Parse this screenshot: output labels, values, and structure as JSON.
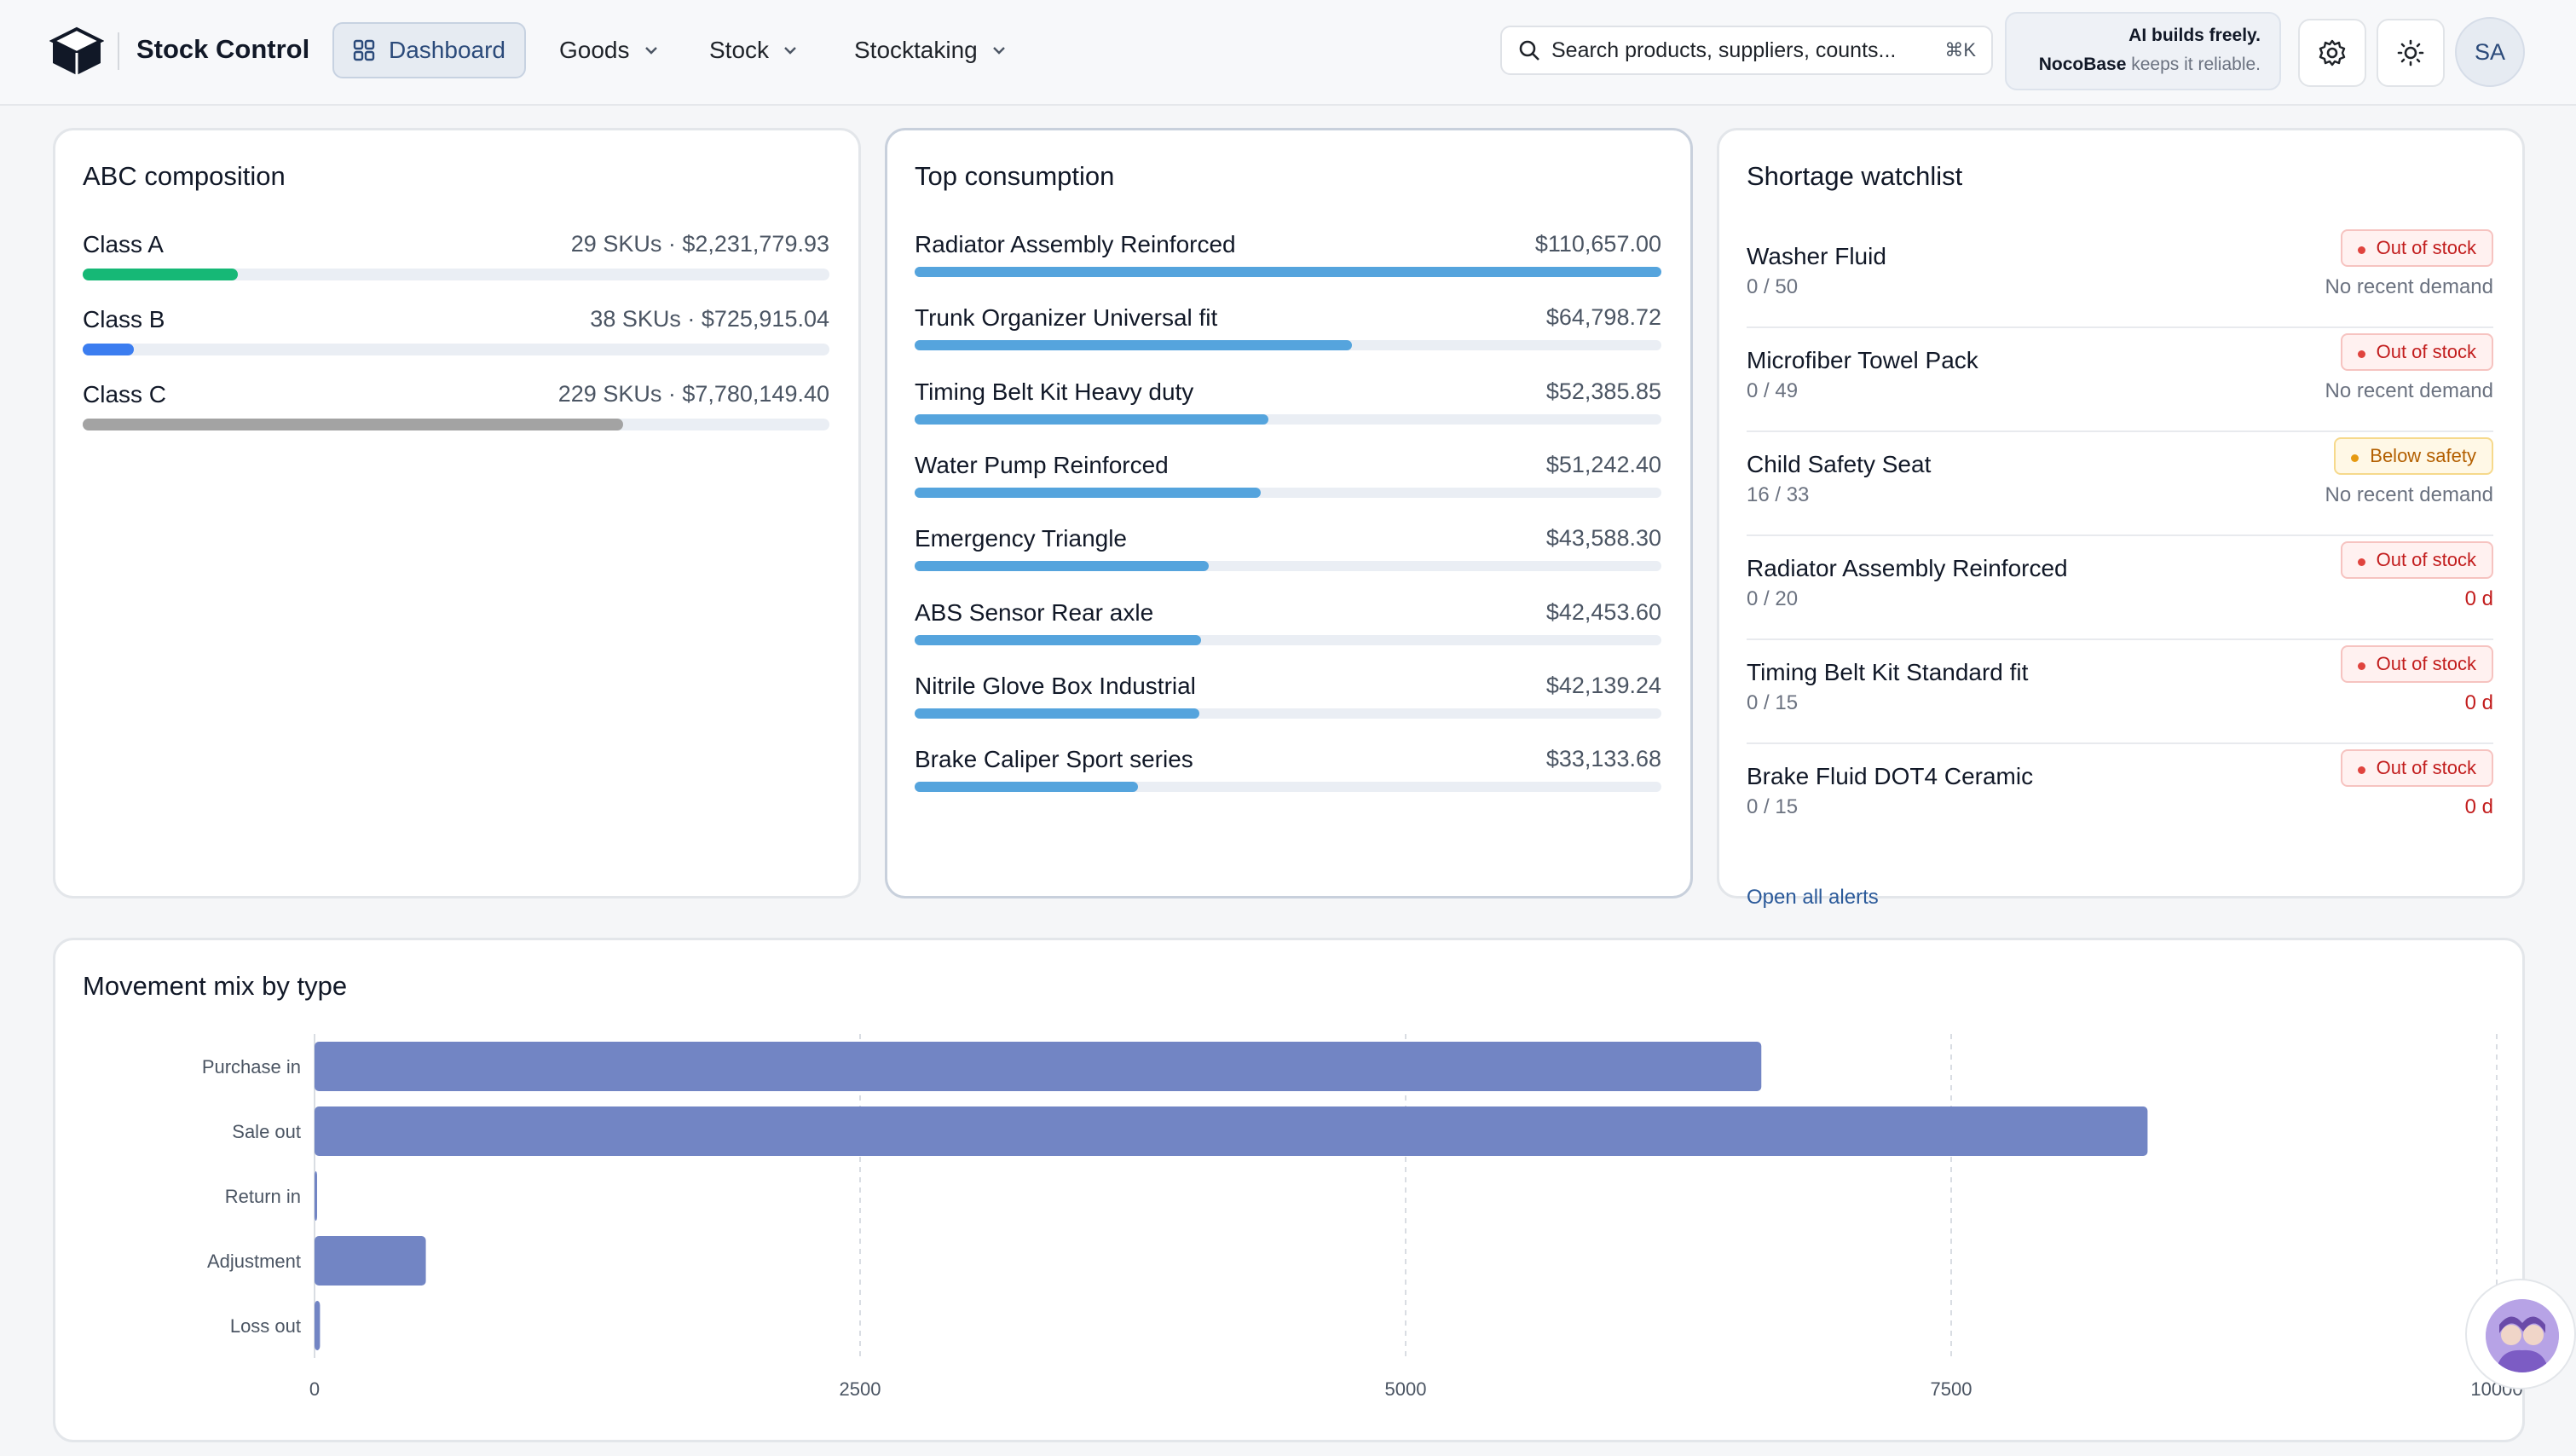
{
  "app": {
    "title": "Stock Control"
  },
  "nav": [
    {
      "label": "Dashboard",
      "active": true
    },
    {
      "label": "Goods"
    },
    {
      "label": "Stock"
    },
    {
      "label": "Stocktaking"
    }
  ],
  "search": {
    "placeholder": "Search products, suppliers, counts...",
    "shortcut": "⌘K"
  },
  "promo": {
    "line1": "AI builds freely.",
    "brand": "NocoBase",
    "tail": "keeps it reliable."
  },
  "user": {
    "initials": "SA"
  },
  "abc": {
    "title": "ABC composition",
    "rows": [
      {
        "label": "Class A",
        "value": "29 SKUs · $2,231,779.93",
        "share": 0.208,
        "color": "#16b876"
      },
      {
        "label": "Class B",
        "value": "38 SKUs · $725,915.04",
        "share": 0.068,
        "color": "#3b7df0"
      },
      {
        "label": "Class C",
        "value": "229 SKUs · $7,780,149.40",
        "share": 0.724,
        "color": "#a3a3a3"
      }
    ]
  },
  "consumption": {
    "title": "Top consumption",
    "color": "#55a4dd",
    "max": 110657.0,
    "rows": [
      {
        "label": "Radiator Assembly Reinforced",
        "value": "$110,657.00",
        "amount": 110657.0
      },
      {
        "label": "Trunk Organizer Universal fit",
        "value": "$64,798.72",
        "amount": 64798.72
      },
      {
        "label": "Timing Belt Kit Heavy duty",
        "value": "$52,385.85",
        "amount": 52385.85
      },
      {
        "label": "Water Pump Reinforced",
        "value": "$51,242.40",
        "amount": 51242.4
      },
      {
        "label": "Emergency Triangle",
        "value": "$43,588.30",
        "amount": 43588.3
      },
      {
        "label": "ABS Sensor Rear axle",
        "value": "$42,453.60",
        "amount": 42453.6
      },
      {
        "label": "Nitrile Glove Box Industrial",
        "value": "$42,139.24",
        "amount": 42139.24
      },
      {
        "label": "Brake Caliper Sport series",
        "value": "$33,133.68",
        "amount": 33133.68
      }
    ]
  },
  "watchlist": {
    "title": "Shortage watchlist",
    "items": [
      {
        "name": "Washer Fluid",
        "stock": "0 / 50",
        "badge": "Out of stock",
        "kind": "out",
        "demand": "No recent demand"
      },
      {
        "name": "Microfiber Towel Pack",
        "stock": "0 / 49",
        "badge": "Out of stock",
        "kind": "out",
        "demand": "No recent demand"
      },
      {
        "name": "Child Safety Seat",
        "stock": "16 / 33",
        "badge": "Below safety",
        "kind": "below",
        "demand": "No recent demand"
      },
      {
        "name": "Radiator Assembly Reinforced",
        "stock": "0 / 20",
        "badge": "Out of stock",
        "kind": "out",
        "demand": "0 d"
      },
      {
        "name": "Timing Belt Kit Standard fit",
        "stock": "0 / 15",
        "badge": "Out of stock",
        "kind": "out",
        "demand": "0 d"
      },
      {
        "name": "Brake Fluid DOT4 Ceramic",
        "stock": "0 / 15",
        "badge": "Out of stock",
        "kind": "out",
        "demand": "0 d"
      }
    ],
    "link": "Open all alerts"
  },
  "movement": {
    "title": "Movement mix by type",
    "chart_data": {
      "type": "bar",
      "orientation": "horizontal",
      "categories": [
        "Purchase in",
        "Sale out",
        "Return in",
        "Adjustment",
        "Loss out"
      ],
      "values": [
        6630,
        8400,
        10,
        510,
        25
      ],
      "xlim": [
        0,
        10000
      ],
      "xticks": [
        "0",
        "2500",
        "5000",
        "7500",
        "10000"
      ],
      "grid": true,
      "color": "#7285c4"
    }
  }
}
